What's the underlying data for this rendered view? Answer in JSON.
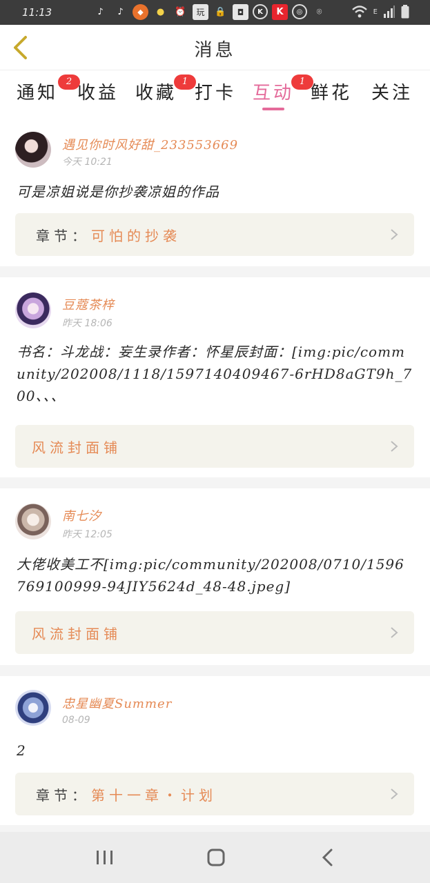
{
  "status_bar": {
    "time": "11:13",
    "icons": [
      "tiktok-icon",
      "tiktok-icon",
      "brave-icon",
      "bulb-icon",
      "alarm-icon",
      "app-wan-icon",
      "lock-icon",
      "box-icon",
      "k-circle-icon",
      "kuaishou-icon",
      "cycle-icon",
      "location-icon"
    ],
    "wan_label": "玩",
    "k_label": "K",
    "k_red_label": "K",
    "signal_label": "E"
  },
  "header": {
    "title": "消息"
  },
  "tabs": [
    {
      "label": "通知",
      "badge": "2"
    },
    {
      "label": "收益",
      "badge": ""
    },
    {
      "label": "收藏",
      "badge": "1"
    },
    {
      "label": "打卡",
      "badge": ""
    },
    {
      "label": "互动",
      "badge": "1",
      "active": true
    },
    {
      "label": "鲜花",
      "badge": ""
    },
    {
      "label": "关注",
      "badge": ""
    }
  ],
  "messages": [
    {
      "name": "遇见你时风好甜_233553669",
      "time": "今天 10:21",
      "content": "可是凉姐说是你抄袭凉姐的作品",
      "link_prefix": "章节：",
      "link_text": "可怕的抄袭"
    },
    {
      "name": "豆蔻茶梓",
      "time": "昨天 18:06",
      "content": "书名：斗龙战：妄生录作者：怀星辰封面：[img:pic/community/202008/1118/1597140409467-6rHD8aGT9h_700、、、",
      "link_prefix": "",
      "link_text": "风流封面铺"
    },
    {
      "name": "南七汐",
      "time": "昨天 12:05",
      "content": "大佬收美工不[img:pic/community/202008/0710/1596769100999-94JIY5624d_48-48.jpeg]",
      "link_prefix": "",
      "link_text": "风流封面铺"
    },
    {
      "name": "忠星幽夏Summer",
      "time": "08-09",
      "content": "2",
      "link_prefix": "章节：",
      "link_text": "第十一章・计划"
    }
  ],
  "colors": {
    "accent_pink": "#e46a9a",
    "name_orange": "#e58a55",
    "badge_red": "#ee3b3b"
  }
}
